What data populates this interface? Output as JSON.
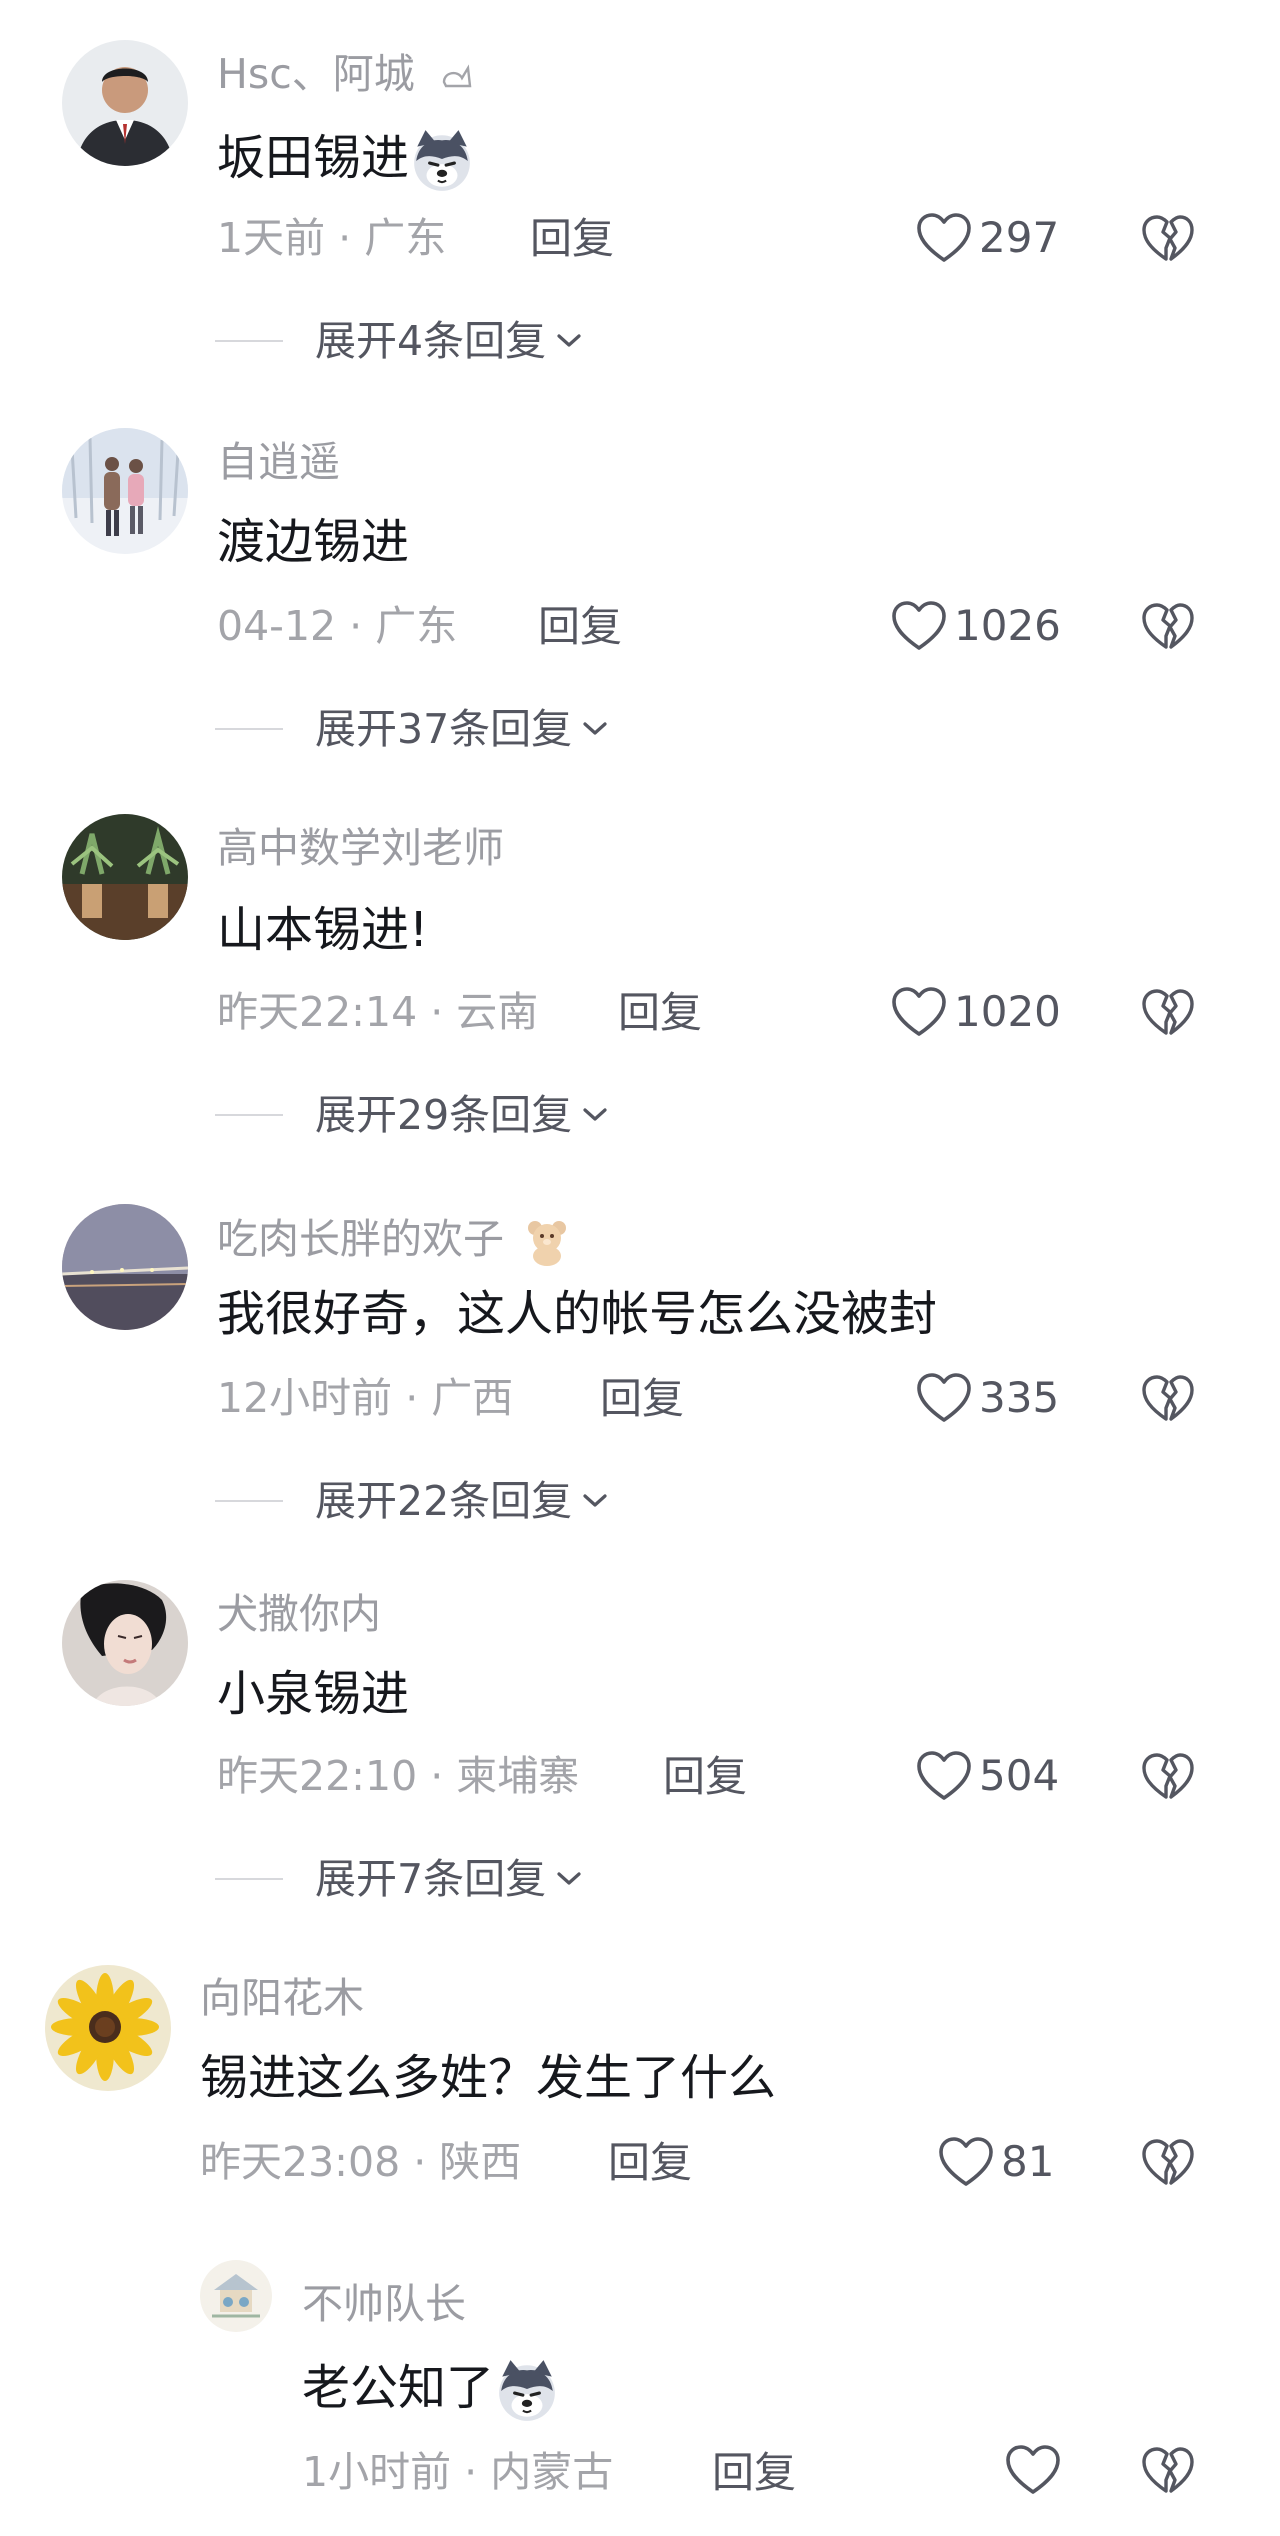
{
  "comments": [
    {
      "username": "Hsc、阿城",
      "text": "坂田锡进",
      "time": "1天前",
      "location": "广东",
      "reply_label": "回复",
      "likes": "297",
      "expand": "展开4条回复"
    },
    {
      "username": "自逍遥",
      "text": "渡边锡进",
      "time": "04-12",
      "location": "广东",
      "reply_label": "回复",
      "likes": "1026",
      "expand": "展开37条回复"
    },
    {
      "username": "高中数学刘老师",
      "text": "山本锡进!",
      "time": "昨天22:14",
      "location": "云南",
      "reply_label": "回复",
      "likes": "1020",
      "expand": "展开29条回复"
    },
    {
      "username": "吃肉长胖的欢子",
      "text": "我很好奇，这人的帐号怎么没被封",
      "time": "12小时前",
      "location": "广西",
      "reply_label": "回复",
      "likes": "335",
      "expand": "展开22条回复"
    },
    {
      "username": "犬撒你内",
      "text": "小泉锡进",
      "time": "昨天22:10",
      "location": "柬埔寨",
      "reply_label": "回复",
      "likes": "504",
      "expand": "展开7条回复"
    },
    {
      "username": "向阳花木",
      "text": "锡进这么多姓？发生了什么",
      "time": "昨天23:08",
      "location": "陕西",
      "reply_label": "回复",
      "likes": "81"
    }
  ],
  "sub_reply": {
    "username": "不帅队长",
    "text": "老公知了",
    "time": "1小时前",
    "location": "内蒙古",
    "reply_label": "回复"
  },
  "colors": {
    "text": "#16181d",
    "muted": "#9b9ca2",
    "action": "#545660"
  }
}
